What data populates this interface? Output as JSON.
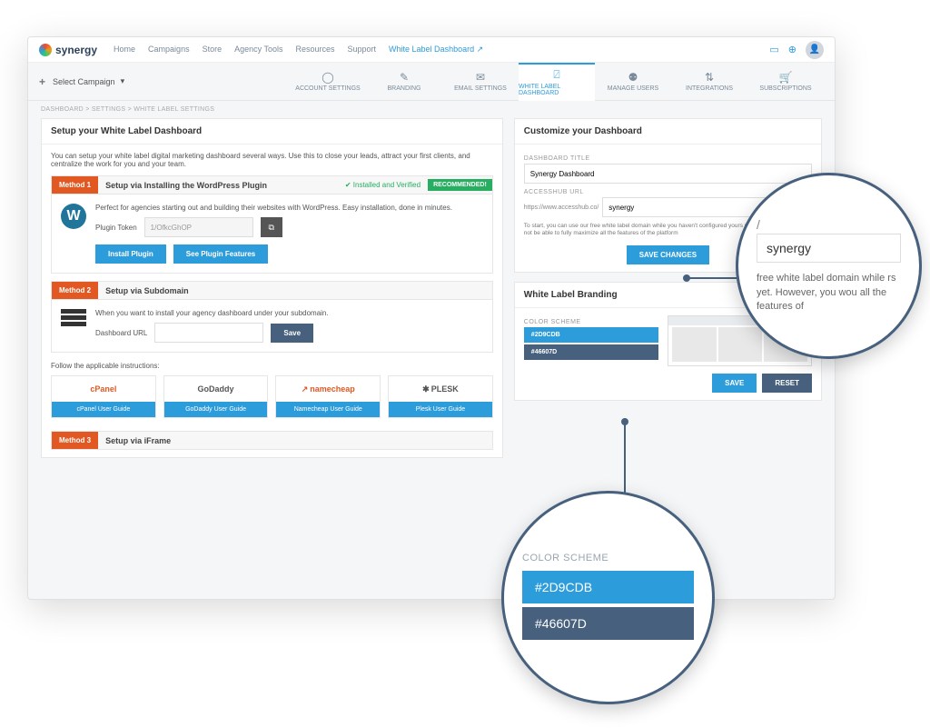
{
  "brand": "synergy",
  "topnav": {
    "home": "Home",
    "campaigns": "Campaigns",
    "store": "Store",
    "agency": "Agency Tools",
    "resources": "Resources",
    "support": "Support",
    "wld": "White Label Dashboard"
  },
  "campaign_selector": "Select Campaign",
  "tabs": {
    "account": "ACCOUNT SETTINGS",
    "branding": "BRANDING",
    "email": "EMAIL SETTINGS",
    "wld": "WHITE LABEL DASHBOARD",
    "users": "MANAGE USERS",
    "integrations": "INTEGRATIONS",
    "subscriptions": "SUBSCRIPTIONS"
  },
  "breadcrumbs": "DASHBOARD   >   SETTINGS   >   WHITE LABEL SETTINGS",
  "setup": {
    "title": "Setup your White Label Dashboard",
    "intro": "You can setup your white label digital marketing dashboard several ways. Use this to close your leads, attract your first clients, and centralize the work for you and your team.",
    "m1": {
      "badge": "Method 1",
      "title": "Setup via Installing the WordPress Plugin",
      "verified": "✔ Installed and Verified",
      "recommended": "RECOMMENDED!",
      "desc": "Perfect for agencies starting out and building their websites with WordPress. Easy installation, done in minutes.",
      "token_label": "Plugin Token",
      "token_value": "1/OfkcGhOP",
      "btn_install": "Install Plugin",
      "btn_features": "See Plugin Features"
    },
    "m2": {
      "badge": "Method 2",
      "title": "Setup via Subdomain",
      "desc": "When you want to install your agency dashboard under your subdomain.",
      "url_label": "Dashboard URL",
      "save": "Save"
    },
    "instructions_label": "Follow the applicable instructions:",
    "providers": {
      "cpanel": {
        "name": "cPanel",
        "btn": "cPanel User Guide",
        "color": "#e25822"
      },
      "godaddy": {
        "name": "GoDaddy",
        "btn": "GoDaddy User Guide",
        "color": "#333"
      },
      "namecheap": {
        "name": "namecheap",
        "btn": "Namecheap User Guide",
        "color": "#e25822"
      },
      "plesk": {
        "name": "PLESK",
        "btn": "Plesk User Guide",
        "color": "#333"
      }
    },
    "m3": {
      "badge": "Method 3",
      "title": "Setup via iFrame"
    }
  },
  "customize": {
    "title": "Customize your Dashboard",
    "dashboard_title_label": "DASHBOARD TITLE",
    "dashboard_title_value": "Synergy Dashboard",
    "accesshub_label": "ACCESSHUB URL",
    "accesshub_prefix": "https://www.accesshub.co/",
    "accesshub_value": "synergy",
    "help": "To start, you can use our free white label domain while you haven't configured yours yet. However, you would not be able to fully maximize all the features of the platform",
    "save": "SAVE CHANGES"
  },
  "branding": {
    "title": "White Label Branding",
    "scheme_label": "COLOR SCHEME",
    "color1": "#2D9CDB",
    "color2": "#46607D",
    "save": "SAVE",
    "reset": "RESET"
  },
  "zoom1": {
    "value": "synergy",
    "text": "free white label domain while rs yet. However, you wou all the features of"
  },
  "zoom2": {
    "label": "COLOR SCHEME",
    "c1": "#2D9CDB",
    "c2": "#46607D"
  }
}
